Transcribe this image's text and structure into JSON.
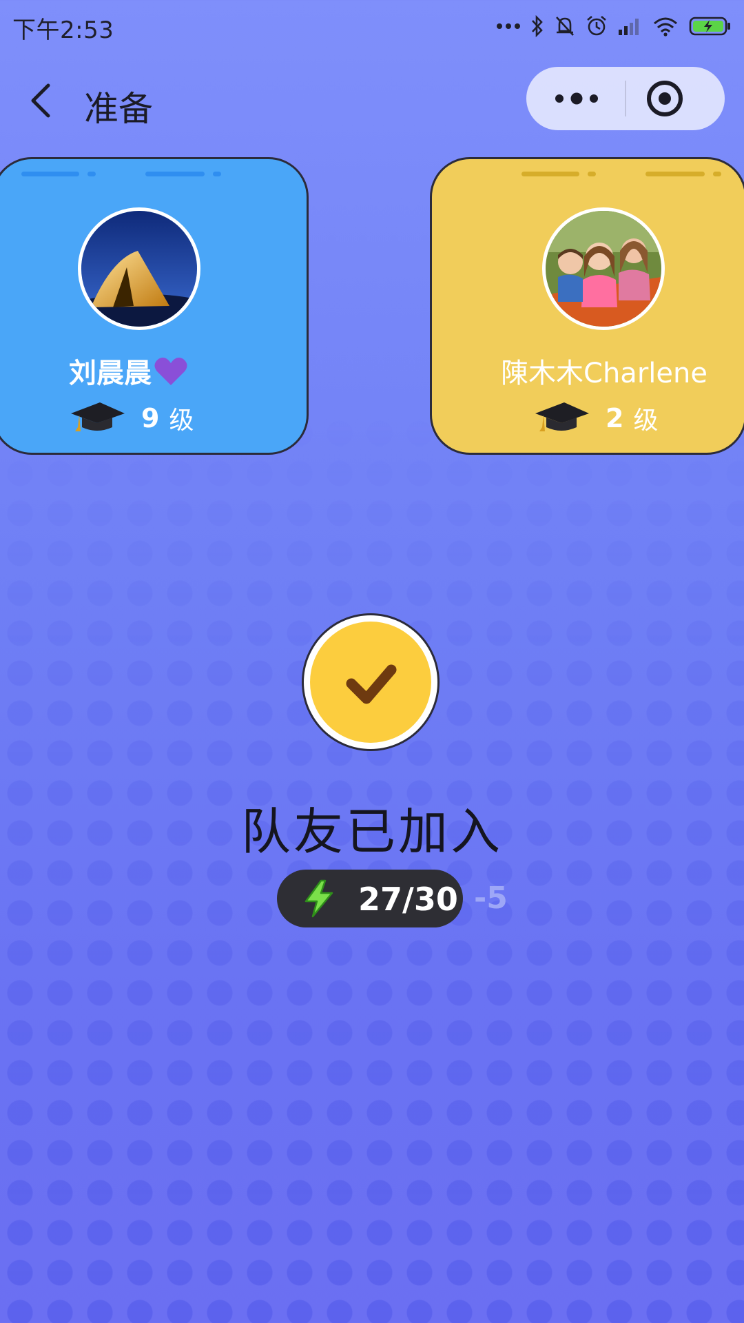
{
  "status_bar": {
    "time": "下午2:53"
  },
  "nav": {
    "title": "准备"
  },
  "players": [
    {
      "name": "刘晨晨",
      "level_value": "9",
      "level_unit": "级",
      "card_color": "#4aa6f8"
    },
    {
      "name": "陳木木Charlene",
      "level_value": "2",
      "level_unit": "级",
      "card_color": "#f1cd5a"
    }
  ],
  "ready": {
    "status_text": "队友已加入",
    "energy_value": "27/30",
    "energy_cost": "-5"
  },
  "colors": {
    "background": "#7687f8",
    "accent_yellow": "#fccd3e",
    "energy_green": "#7be04a"
  },
  "icons": [
    "back-icon",
    "more-icon",
    "target-close-icon",
    "heart-icon",
    "graduation-cap-icon",
    "checkmark-icon",
    "lightning-bolt-icon"
  ]
}
